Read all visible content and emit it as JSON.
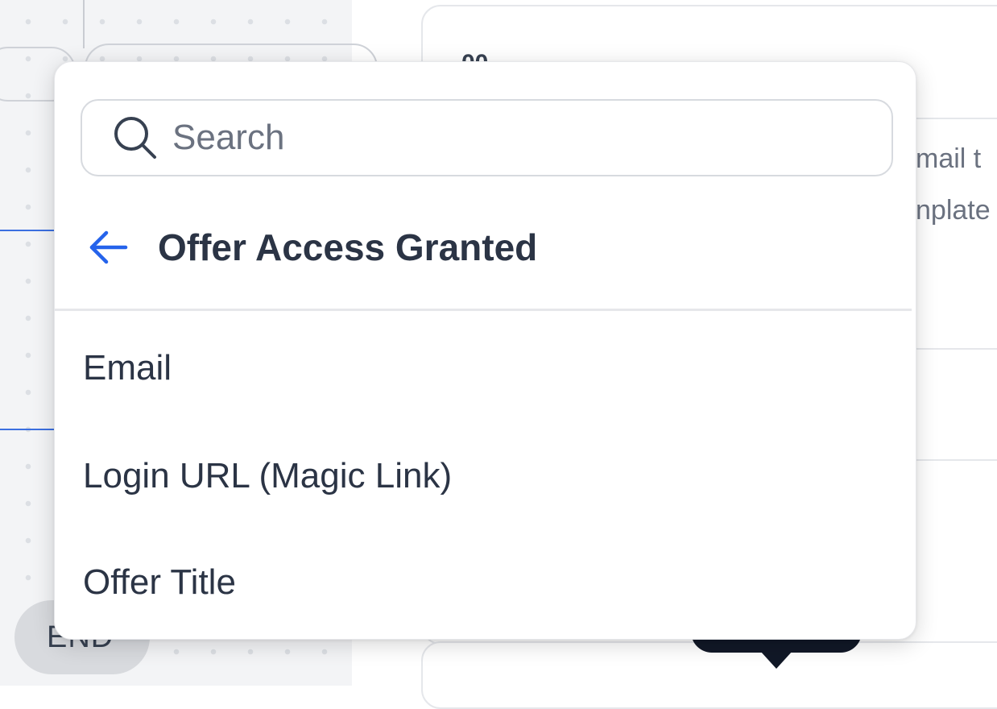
{
  "background": {
    "end_label": "END",
    "panel_heading_fragment": "00",
    "panel_text_lines": [
      "mail t",
      "nplate"
    ]
  },
  "dropdown": {
    "search": {
      "placeholder": "Search",
      "value": ""
    },
    "back": {
      "label": "Offer Access Granted",
      "icon": "arrow-left-icon"
    },
    "options": [
      {
        "label": "Email"
      },
      {
        "label": "Login URL (Magic Link)"
      },
      {
        "label": "Offer Title"
      }
    ]
  },
  "colors": {
    "accent": "#2563eb",
    "text": "#2b3445",
    "muted": "#6b7280",
    "border": "#d7dadf",
    "tooltip": "#111827"
  }
}
